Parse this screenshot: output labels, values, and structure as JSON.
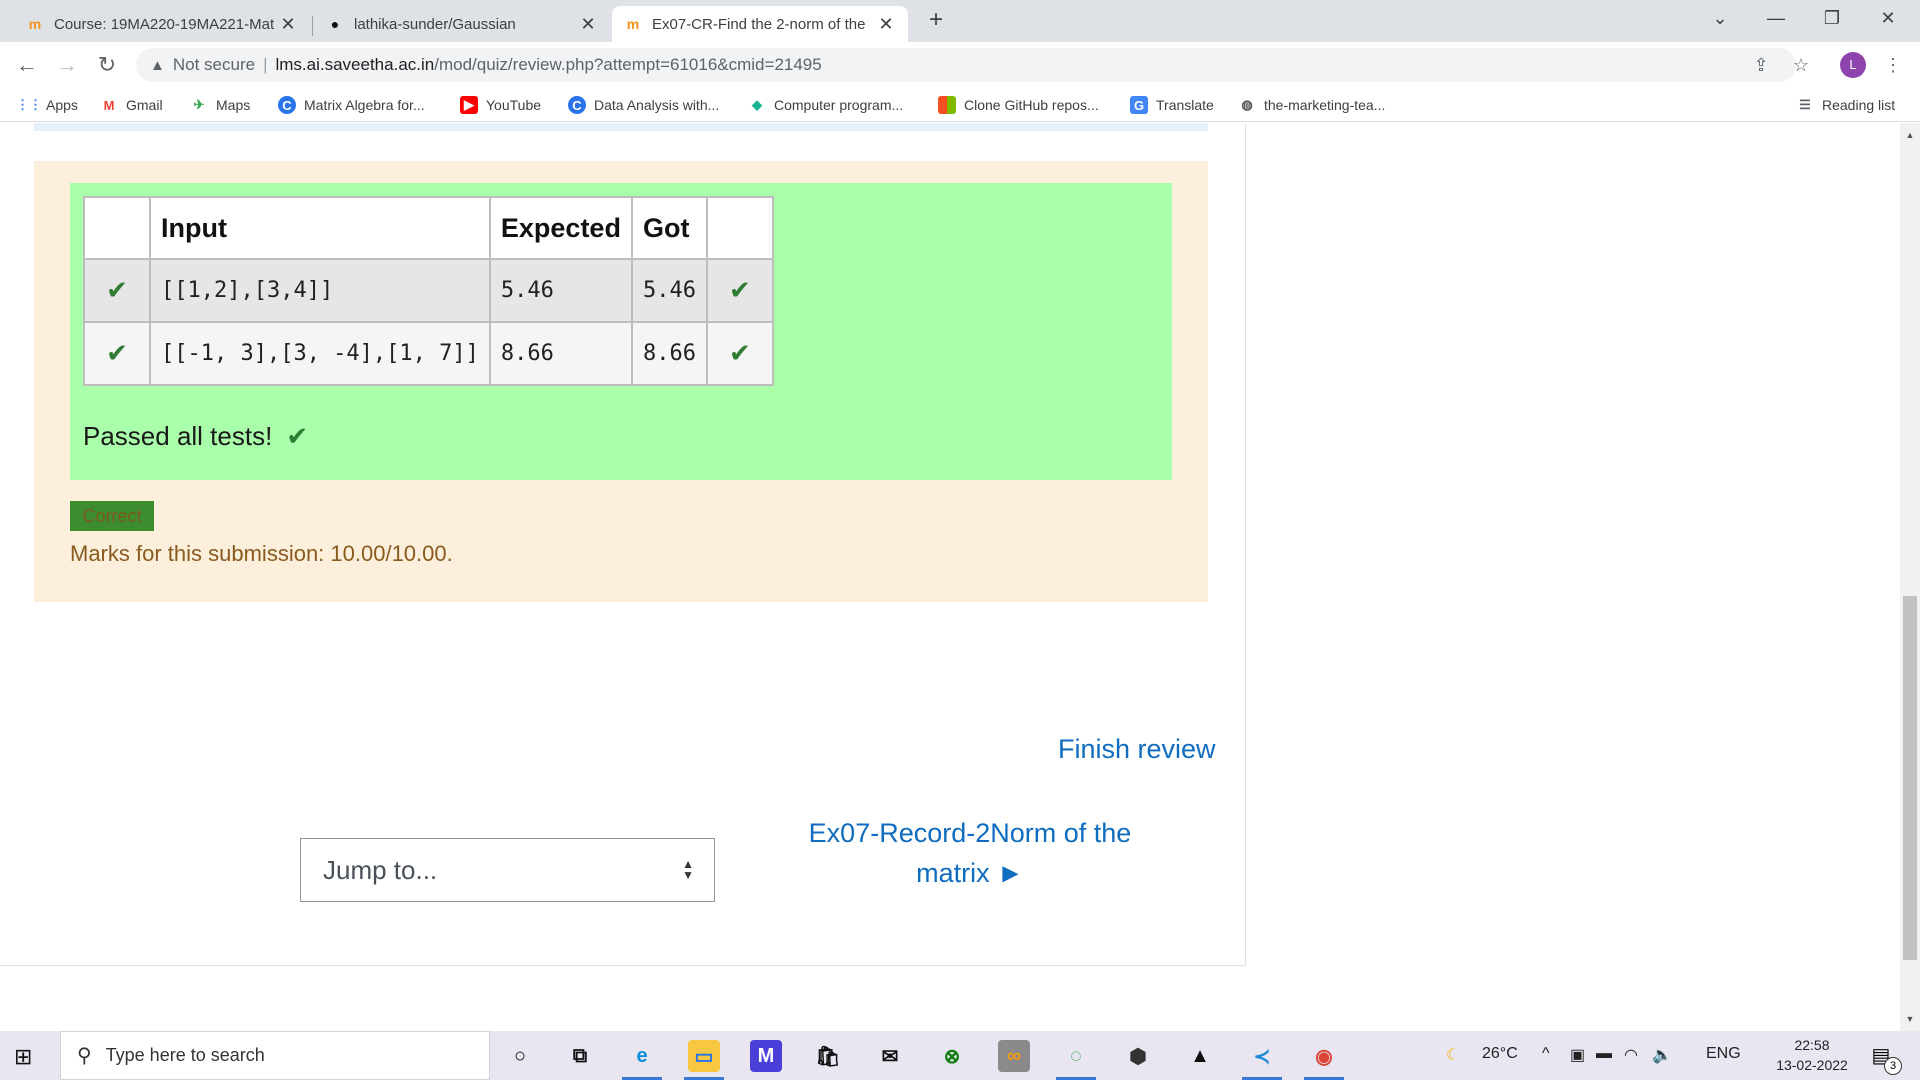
{
  "browser": {
    "tabs": [
      {
        "title": "Course: 19MA220-19MA221-Mat",
        "active": false
      },
      {
        "title": "lathika-sunder/Gaussian",
        "active": false
      },
      {
        "title": "Ex07-CR-Find the 2-norm of the",
        "active": true
      }
    ],
    "new_tab_glyph": "+",
    "address": {
      "security_text": "Not secure",
      "host": "lms.ai.saveetha.ac.in",
      "path": "/mod/quiz/review.php?attempt=61016&cmid=21495"
    },
    "profile_initial": "L",
    "bookmarks": [
      {
        "label": "Apps",
        "icon": "apps-icon"
      },
      {
        "label": "Gmail",
        "icon": "gmail-icon"
      },
      {
        "label": "Maps",
        "icon": "maps-icon"
      },
      {
        "label": "Matrix Algebra for...",
        "icon": "c-icon"
      },
      {
        "label": "YouTube",
        "icon": "youtube-icon"
      },
      {
        "label": "Data Analysis with...",
        "icon": "c-icon"
      },
      {
        "label": "Computer program...",
        "icon": "shield-icon"
      },
      {
        "label": "Clone GitHub repos...",
        "icon": "microsoft-icon"
      },
      {
        "label": "Translate",
        "icon": "translate-icon"
      },
      {
        "label": "the-marketing-tea...",
        "icon": "globe-icon"
      }
    ],
    "reading_list": "Reading list"
  },
  "results": {
    "headers": [
      "",
      "Input",
      "Expected",
      "Got",
      ""
    ],
    "rows": [
      {
        "input": "[[1,2],[3,4]]",
        "expected": "5.46",
        "got": "5.46"
      },
      {
        "input": "[[-1, 3],[3, -4],[1, 7]]",
        "expected": "8.66",
        "got": "8.66"
      }
    ],
    "check_glyph": "✔",
    "passed_text": "Passed all tests!"
  },
  "feedback": {
    "badge": "Correct",
    "marks": "Marks for this submission: 10.00/10.00."
  },
  "nav": {
    "finish_review": "Finish review",
    "jump_placeholder": "Jump to...",
    "next_line1": "Ex07-Record-2Norm of the",
    "next_line2": "matrix ►"
  },
  "taskbar": {
    "search_placeholder": "Type here to search",
    "temperature": "26°C",
    "language": "ENG",
    "time": "22:58",
    "date": "13-02-2022",
    "notification_count": "3"
  },
  "colors": {
    "link": "#0f6cbf",
    "pass_green": "#aaffaa",
    "feedback_bg": "#fcefdc",
    "check": "#2e7d32"
  }
}
